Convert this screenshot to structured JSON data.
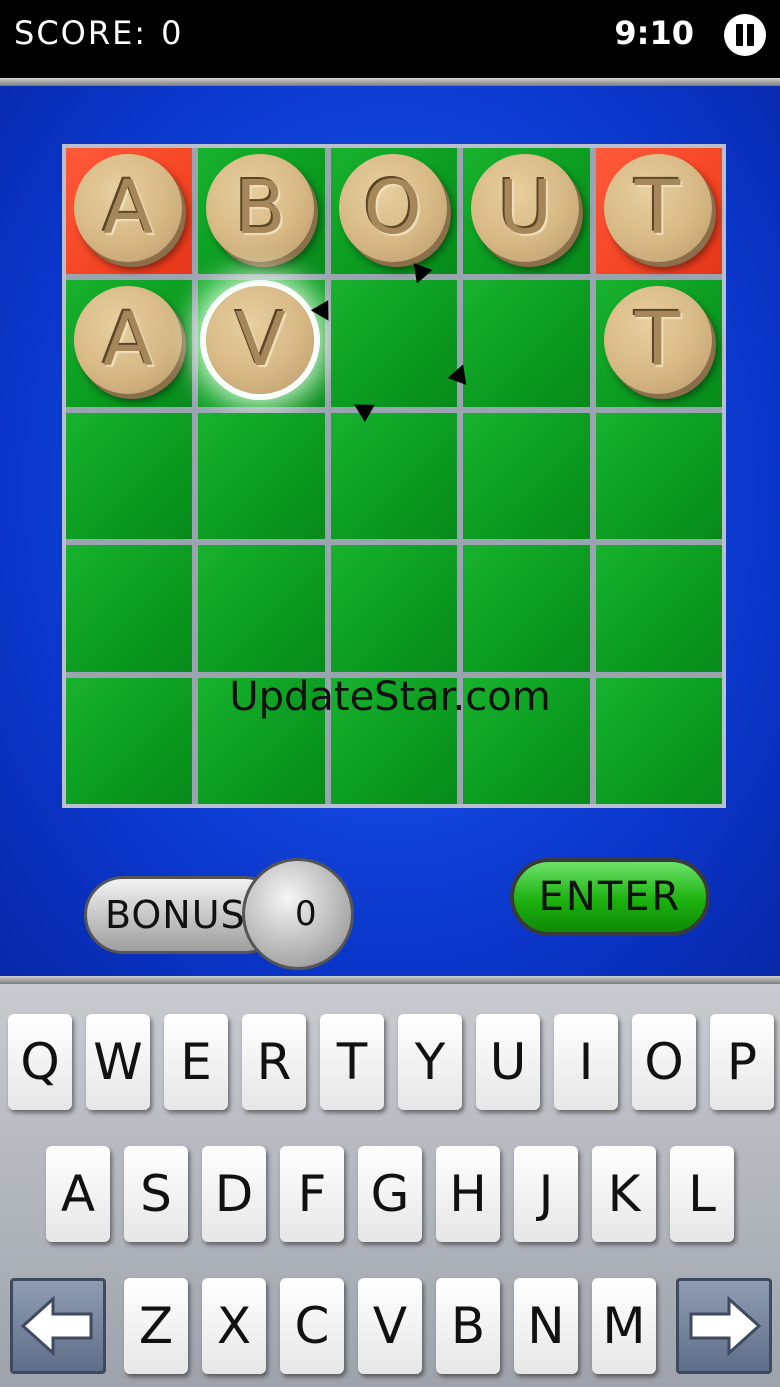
{
  "topbar": {
    "score_label": "SCORE:",
    "score_value": "0",
    "timer": "9:10",
    "pause_icon": "pause-icon"
  },
  "board": {
    "rows": [
      [
        {
          "letter": "A",
          "cell": "red"
        },
        {
          "letter": "B",
          "cell": "green"
        },
        {
          "letter": "O",
          "cell": "green"
        },
        {
          "letter": "U",
          "cell": "green"
        },
        {
          "letter": "T",
          "cell": "red"
        }
      ],
      [
        {
          "letter": "A",
          "cell": "green"
        },
        {
          "letter": "V",
          "cell": "green",
          "highlighted": true
        },
        {
          "letter": "",
          "cell": "green"
        },
        {
          "letter": "",
          "cell": "green"
        },
        {
          "letter": "T",
          "cell": "green"
        }
      ],
      [
        {
          "letter": "",
          "cell": "green"
        },
        {
          "letter": "",
          "cell": "green"
        },
        {
          "letter": "",
          "cell": "green"
        },
        {
          "letter": "",
          "cell": "green"
        },
        {
          "letter": "",
          "cell": "green"
        }
      ],
      [
        {
          "letter": "",
          "cell": "green"
        },
        {
          "letter": "",
          "cell": "green"
        },
        {
          "letter": "",
          "cell": "green"
        },
        {
          "letter": "",
          "cell": "green"
        },
        {
          "letter": "",
          "cell": "green"
        }
      ],
      [
        {
          "letter": "",
          "cell": "green"
        },
        {
          "letter": "",
          "cell": "green"
        },
        {
          "letter": "",
          "cell": "green"
        },
        {
          "letter": "",
          "cell": "green"
        },
        {
          "letter": "",
          "cell": "green"
        }
      ]
    ]
  },
  "watermark": "UpdateStar.com",
  "bonus": {
    "label": "BONUS",
    "value": "0"
  },
  "enter_label": "ENTER",
  "keyboard": {
    "row1": [
      "Q",
      "W",
      "E",
      "R",
      "T",
      "Y",
      "U",
      "I",
      "O",
      "P"
    ],
    "row2": [
      "A",
      "S",
      "D",
      "F",
      "G",
      "H",
      "J",
      "K",
      "L"
    ],
    "row3": [
      "Z",
      "X",
      "C",
      "V",
      "B",
      "N",
      "M"
    ],
    "left_icon": "left-arrow-icon",
    "right_icon": "right-arrow-icon"
  },
  "colors": {
    "board_green": "#0ea321",
    "cell_red": "#f2411f",
    "panel_blue": "#1448e0",
    "enter_green": "#1bb10e"
  }
}
